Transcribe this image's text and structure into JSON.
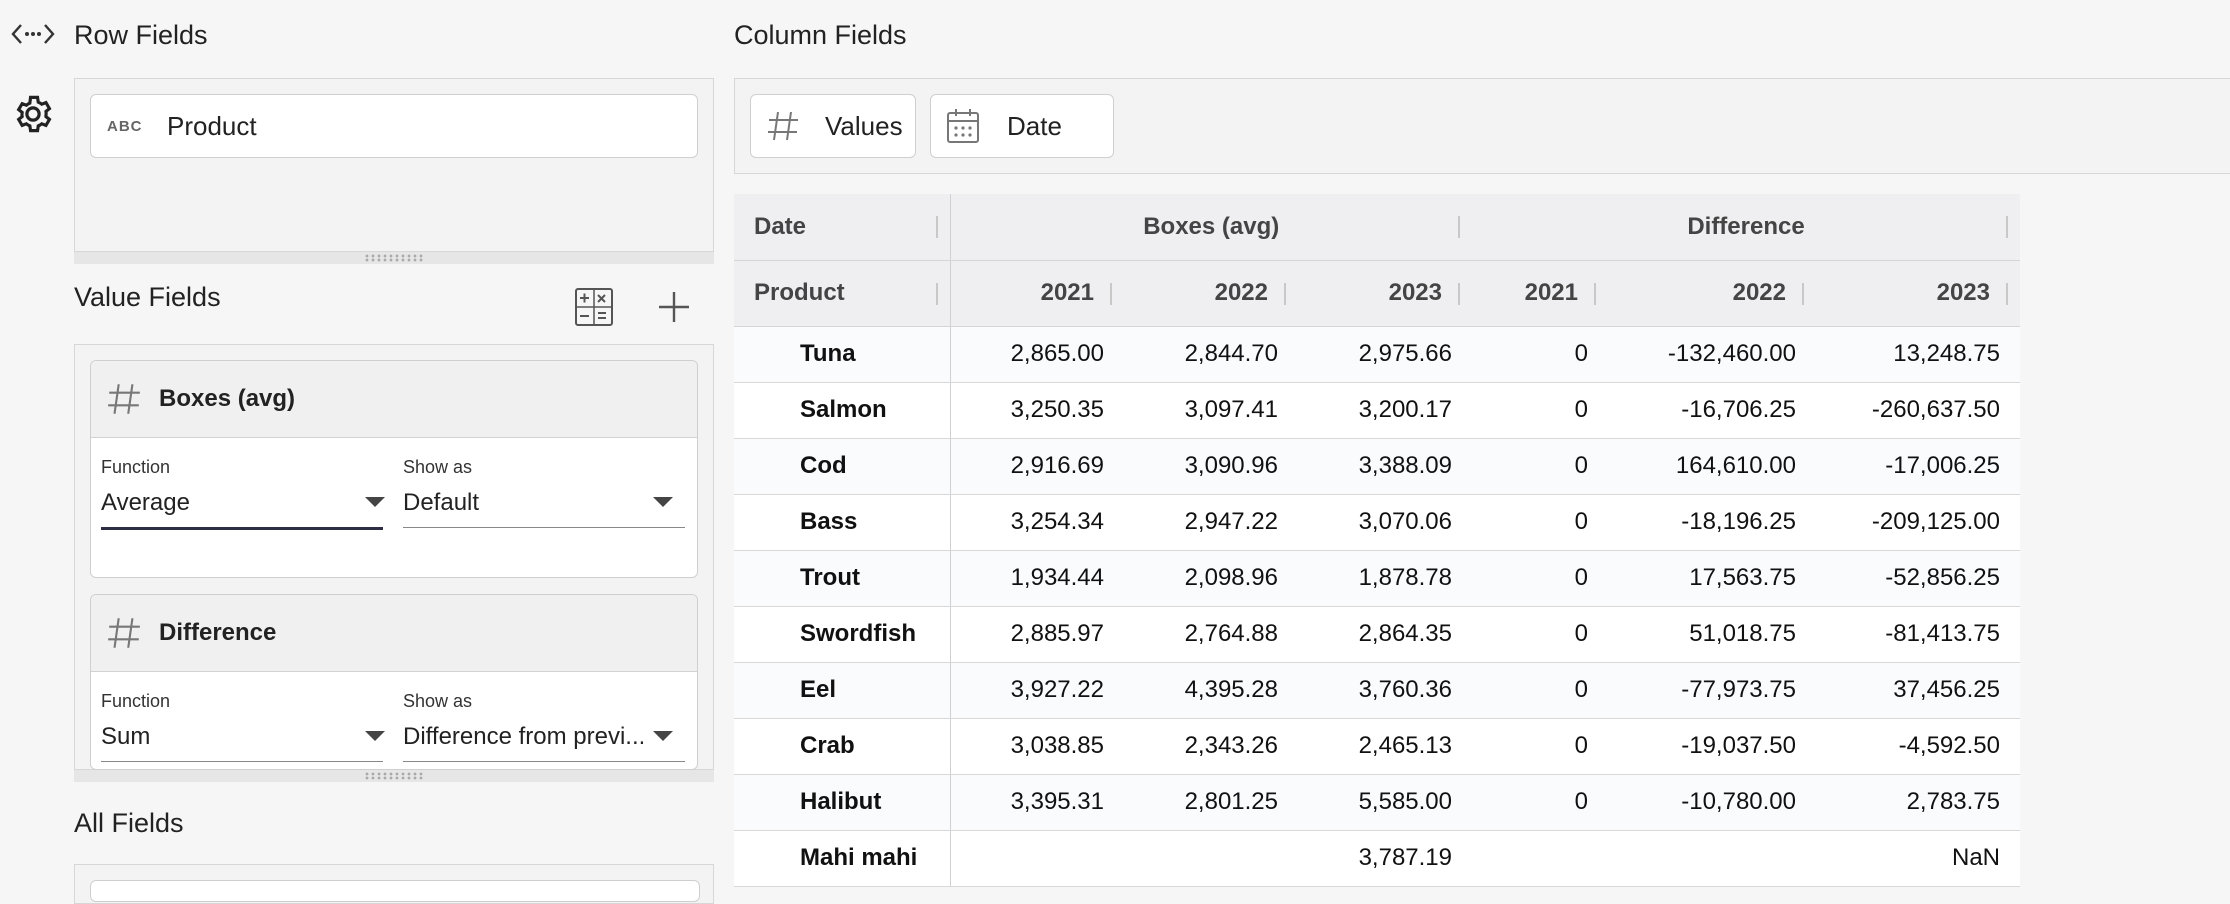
{
  "sections": {
    "row_fields": "Row Fields",
    "column_fields": "Column Fields",
    "value_fields": "Value Fields",
    "all_fields": "All Fields"
  },
  "icons": {
    "collapse": "code-arrows-icon",
    "settings": "gear-icon",
    "calculator": "calculator-icon",
    "add": "plus-icon",
    "hash": "hash-icon",
    "calendar": "calendar-icon",
    "text_type": "abc-type-icon"
  },
  "row_fields": {
    "items": [
      {
        "type_label": "ABC",
        "label": "Product"
      }
    ]
  },
  "column_fields": {
    "items": [
      {
        "label": "Values"
      },
      {
        "label": "Date"
      }
    ]
  },
  "value_fields": {
    "items": [
      {
        "title": "Boxes (avg)",
        "function_label": "Function",
        "function_value": "Average",
        "show_as_label": "Show as",
        "show_as_value": "Default"
      },
      {
        "title": "Difference",
        "function_label": "Function",
        "function_value": "Sum",
        "show_as_label": "Show as",
        "show_as_value": "Difference from previ..."
      }
    ]
  },
  "table": {
    "header_row1": {
      "dimension": "Date",
      "group1": "Boxes (avg)",
      "group2": "Difference"
    },
    "header_row2": {
      "dimension": "Product",
      "years": [
        "2021",
        "2022",
        "2023",
        "2021",
        "2022",
        "2023"
      ]
    },
    "rows": [
      {
        "product": "Tuna",
        "cells": [
          "2,865.00",
          "2,844.70",
          "2,975.66",
          "0",
          "-132,460.00",
          "13,248.75"
        ]
      },
      {
        "product": "Salmon",
        "cells": [
          "3,250.35",
          "3,097.41",
          "3,200.17",
          "0",
          "-16,706.25",
          "-260,637.50"
        ]
      },
      {
        "product": "Cod",
        "cells": [
          "2,916.69",
          "3,090.96",
          "3,388.09",
          "0",
          "164,610.00",
          "-17,006.25"
        ]
      },
      {
        "product": "Bass",
        "cells": [
          "3,254.34",
          "2,947.22",
          "3,070.06",
          "0",
          "-18,196.25",
          "-209,125.00"
        ]
      },
      {
        "product": "Trout",
        "cells": [
          "1,934.44",
          "2,098.96",
          "1,878.78",
          "0",
          "17,563.75",
          "-52,856.25"
        ]
      },
      {
        "product": "Swordfish",
        "cells": [
          "2,885.97",
          "2,764.88",
          "2,864.35",
          "0",
          "51,018.75",
          "-81,413.75"
        ]
      },
      {
        "product": "Eel",
        "cells": [
          "3,927.22",
          "4,395.28",
          "3,760.36",
          "0",
          "-77,973.75",
          "37,456.25"
        ]
      },
      {
        "product": "Crab",
        "cells": [
          "3,038.85",
          "2,343.26",
          "2,465.13",
          "0",
          "-19,037.50",
          "-4,592.50"
        ]
      },
      {
        "product": "Halibut",
        "cells": [
          "3,395.31",
          "2,801.25",
          "5,585.00",
          "0",
          "-10,780.00",
          "2,783.75"
        ]
      },
      {
        "product": "Mahi mahi",
        "cells": [
          "",
          "",
          "3,787.19",
          "",
          "",
          "NaN"
        ]
      }
    ]
  }
}
